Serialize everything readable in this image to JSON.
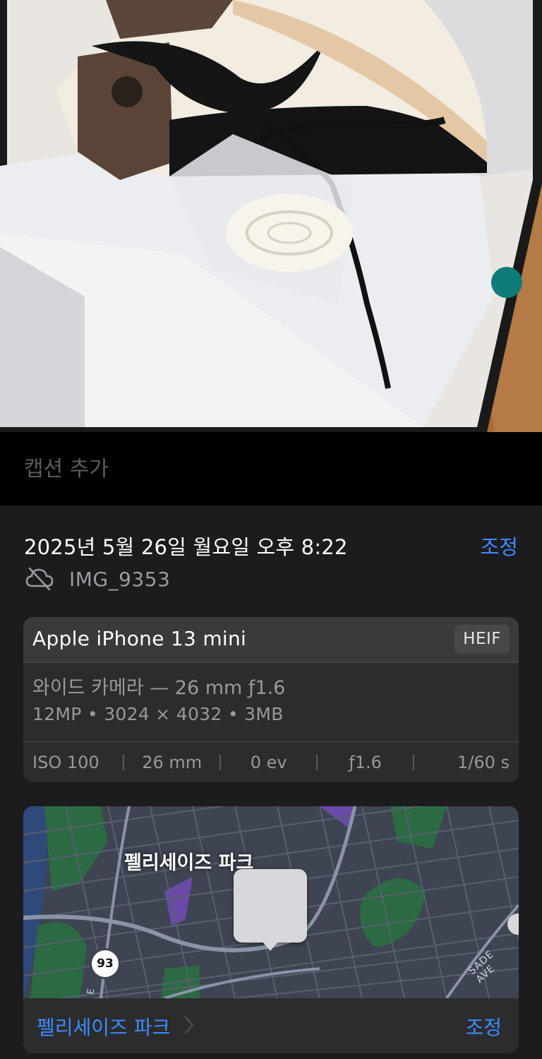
{
  "caption": {
    "placeholder": "캡션 추가"
  },
  "info": {
    "datetime": "2025년 5월 26일 월요일 오후 8:22",
    "adjust_label": "조정",
    "file_name": "IMG_9353",
    "icons": {
      "cloud_status": "cloud-off-icon"
    }
  },
  "device": {
    "name": "Apple iPhone 13 mini",
    "format": "HEIF",
    "lens": "와이드 카메라 — 26 mm ƒ1.6",
    "specs": "12MP • 3024 × 4032 • 3MB",
    "exif": {
      "iso": "ISO 100",
      "focal_length": "26 mm",
      "exposure": "0 ev",
      "aperture": "ƒ1.6",
      "shutter": "1/60 s"
    }
  },
  "map": {
    "area_label": "펠리세이즈 파크",
    "route_number": "93",
    "street_label": "SADE AVE",
    "street_label_e": "E",
    "place_link": "펠리세이즈 파크",
    "adjust_label": "조정"
  },
  "colors": {
    "accent": "#3d8bff",
    "background": "#1c1c1e",
    "card": "#2c2c2e"
  }
}
